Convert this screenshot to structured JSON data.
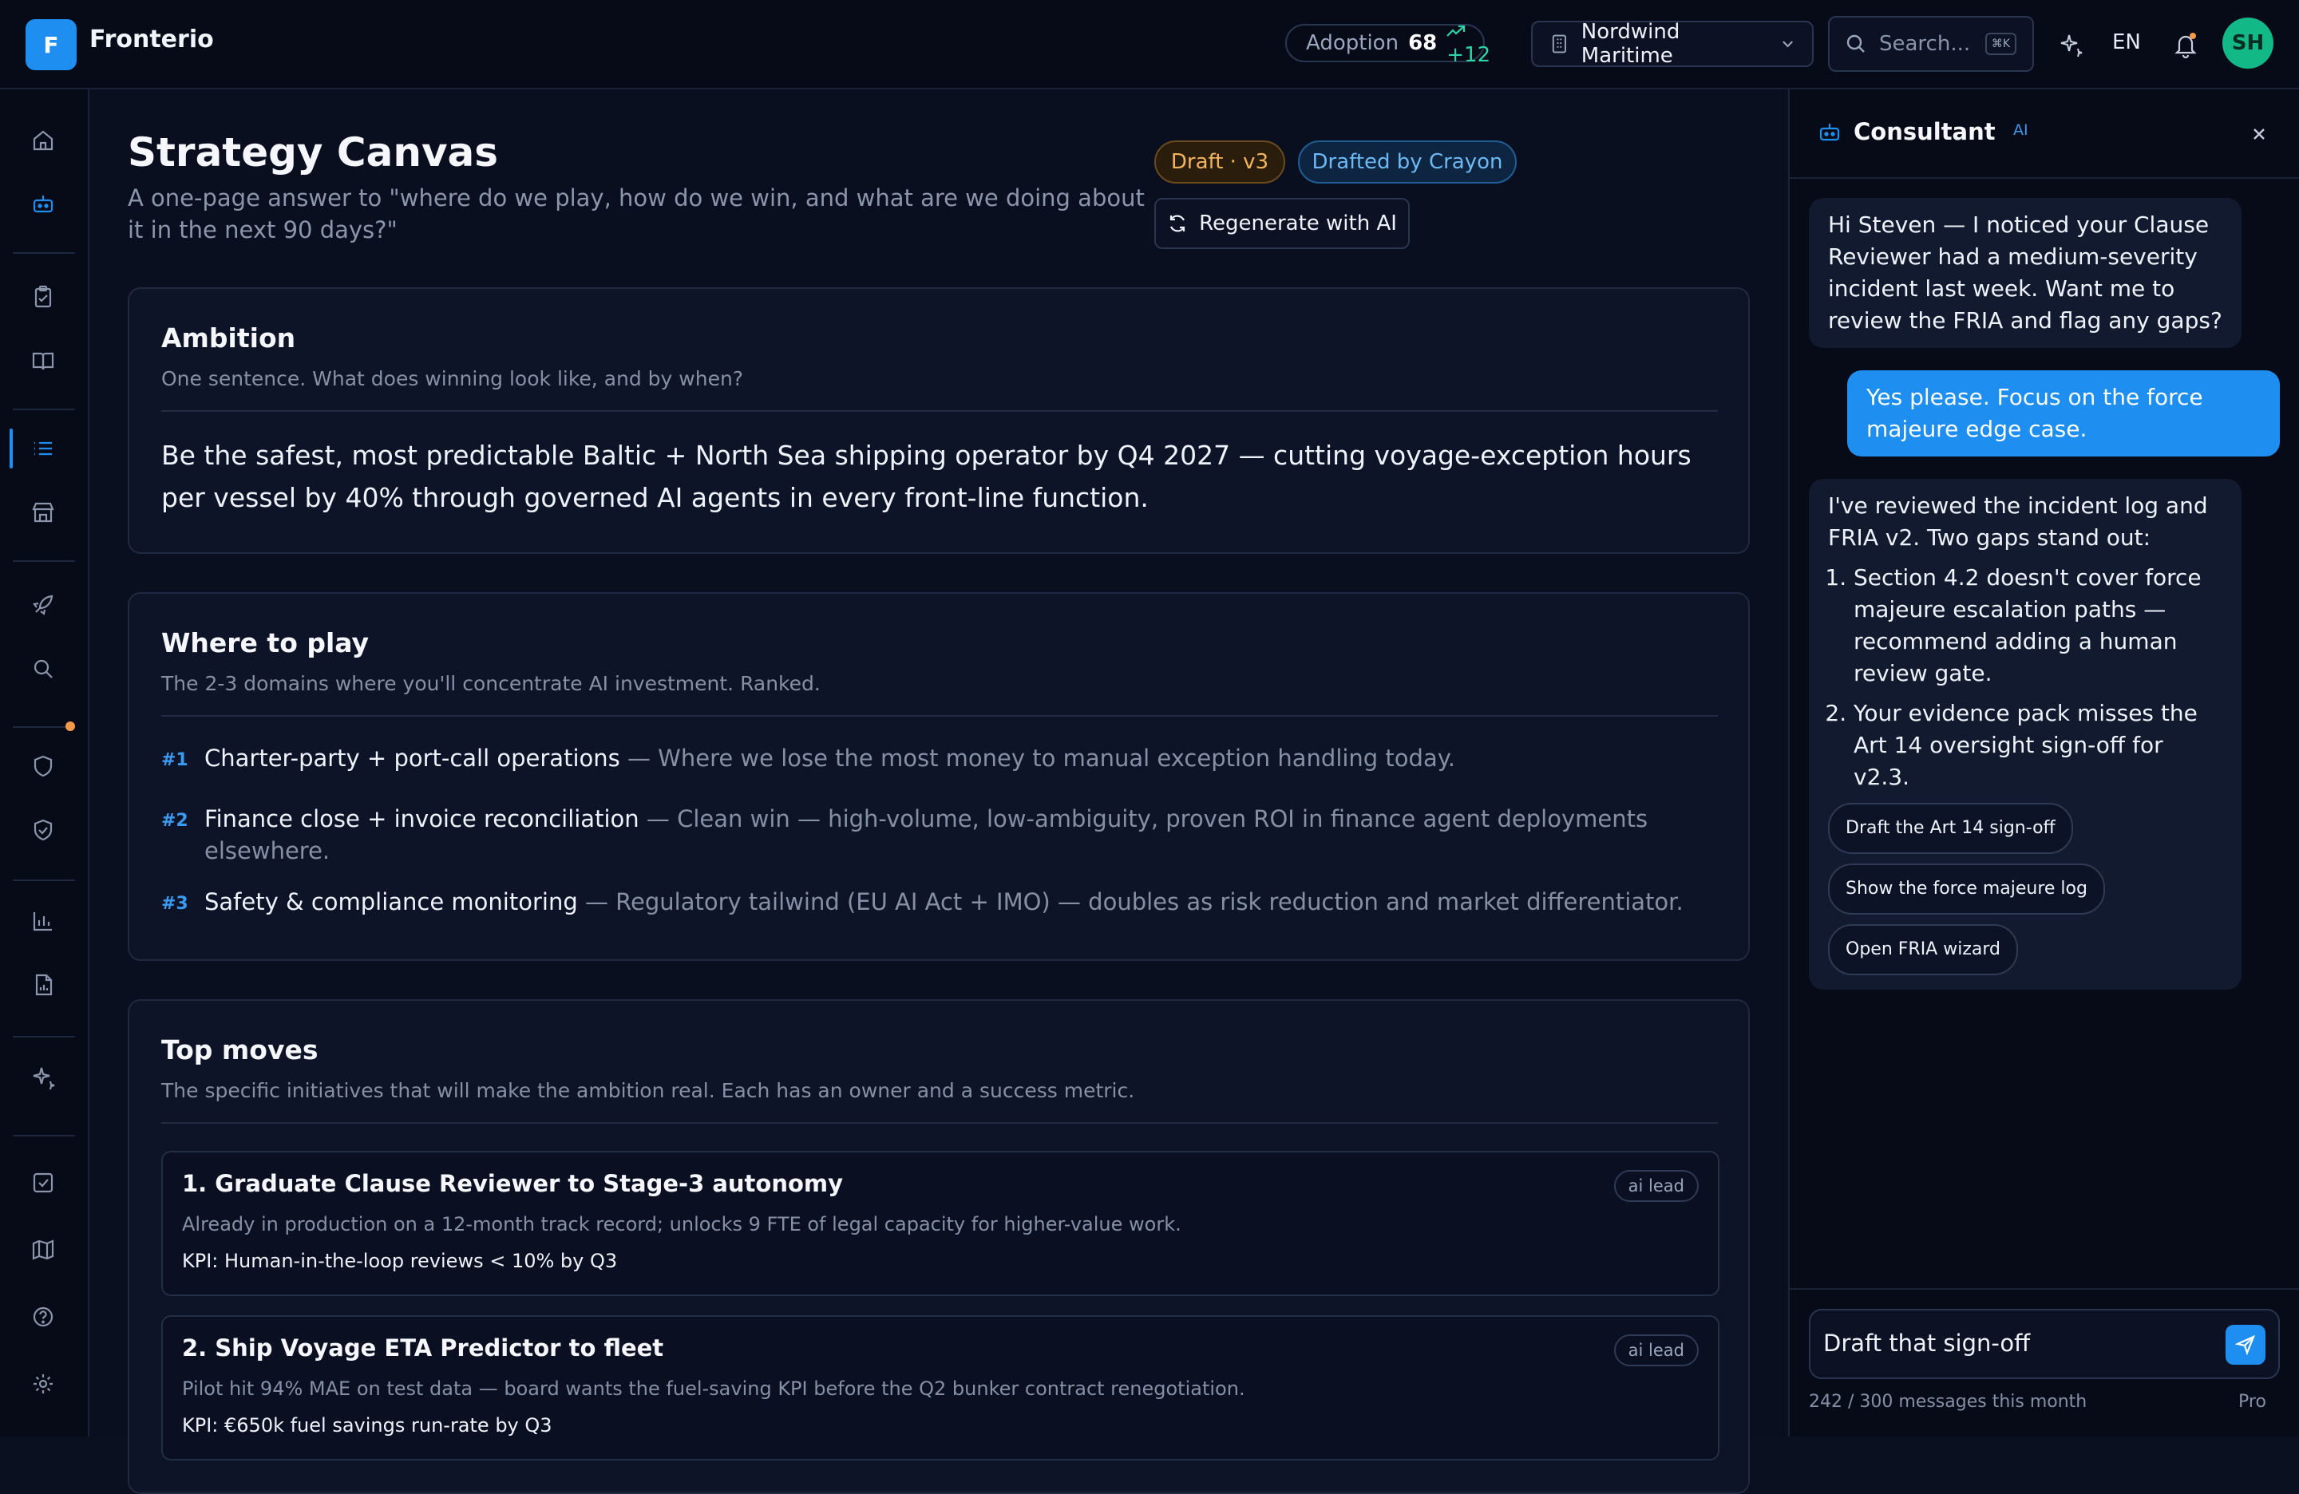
{
  "app": {
    "logo_letter": "F",
    "name": "Fronterio"
  },
  "topbar": {
    "adoption_label": "Adoption",
    "adoption_value": "68",
    "adoption_delta": "+12",
    "org_name": "Nordwind Maritime",
    "search_placeholder": "Search...",
    "search_shortcut": "⌘K",
    "language": "EN",
    "avatar_initials": "SH"
  },
  "sidebar": {
    "icons": [
      "home-icon",
      "robot-icon",
      "clipboard-icon",
      "book-icon",
      "list-icon",
      "archive-icon",
      "rocket-icon",
      "search-icon",
      "shield-icon",
      "shield-check-icon",
      "bar-chart-icon",
      "report-icon",
      "sparkle-icon",
      "checkbox-icon",
      "map-icon",
      "help-icon",
      "settings-icon"
    ],
    "active": "list-icon"
  },
  "page": {
    "title": "Strategy Canvas",
    "subtitle": "A one-page answer to \"where do we play, how do we win, and what are we doing about it in the next 90 days?\"",
    "status_badge": "Draft · v3",
    "author_badge": "Drafted by Crayon",
    "regenerate_label": "Regenerate with AI"
  },
  "ambition": {
    "heading": "Ambition",
    "hint": "One sentence. What does winning look like, and by when?",
    "text": "Be the safest, most predictable Baltic + North Sea shipping operator by Q4 2027 — cutting voyage-exception hours per vessel by 40% through governed AI agents in every front-line function."
  },
  "where_to_play": {
    "heading": "Where to play",
    "hint": "The 2-3 domains where you'll concentrate AI investment. Ranked.",
    "items": [
      {
        "rank": "#1",
        "name": "Charter-party + port-call operations",
        "reason": " — Where we lose the most money to manual exception handling today."
      },
      {
        "rank": "#2",
        "name": "Finance close + invoice reconciliation",
        "reason": " — Clean win — high-volume, low-ambiguity, proven ROI in finance agent deployments elsewhere."
      },
      {
        "rank": "#3",
        "name": "Safety & compliance monitoring",
        "reason": " — Regulatory tailwind (EU AI Act + IMO) — doubles as risk reduction and market differentiator."
      }
    ]
  },
  "top_moves": {
    "heading": "Top moves",
    "hint": "The specific initiatives that will make the ambition real. Each has an owner and a success metric.",
    "items": [
      {
        "title": "1. Graduate Clause Reviewer to Stage-3 autonomy",
        "tag": "ai lead",
        "desc": "Already in production on a 12-month track record; unlocks 9 FTE of legal capacity for higher-value work.",
        "kpi": "KPI: Human-in-the-loop reviews < 10% by Q3"
      },
      {
        "title": "2. Ship Voyage ETA Predictor to fleet",
        "tag": "ai lead",
        "desc": "Pilot hit 94% MAE on test data — board wants the fuel-saving KPI before the Q2 bunker contract renegotiation.",
        "kpi": "KPI: €650k fuel savings run-rate by Q3"
      }
    ]
  },
  "consultant": {
    "title": "Consultant",
    "ai_tag": "AI",
    "messages": [
      {
        "role": "ai",
        "text": "Hi Steven — I noticed your Clause Reviewer had a medium-severity incident last week. Want me to review the FRIA and flag any gaps?"
      },
      {
        "role": "user",
        "text": "Yes please. Focus on the force majeure edge case."
      },
      {
        "role": "ai",
        "text": "I've reviewed the incident log and FRIA v2. Two gaps stand out:",
        "points": [
          "Section 4.2 doesn't cover force majeure escalation paths — recommend adding a human review gate.",
          "Your evidence pack misses the Art 14 oversight sign-off for v2.3."
        ],
        "chips": [
          "Draft the Art 14 sign-off",
          "Show the force majeure log",
          "Open FRIA wizard"
        ]
      }
    ],
    "input_value": "Draft that sign-off",
    "quota": "242 / 300 messages this month",
    "plan": "Pro"
  },
  "colors": {
    "accent": "#1e8ff0",
    "success": "#2dd4a7",
    "warning": "#f2b45c",
    "background": "#0a0f1f"
  }
}
